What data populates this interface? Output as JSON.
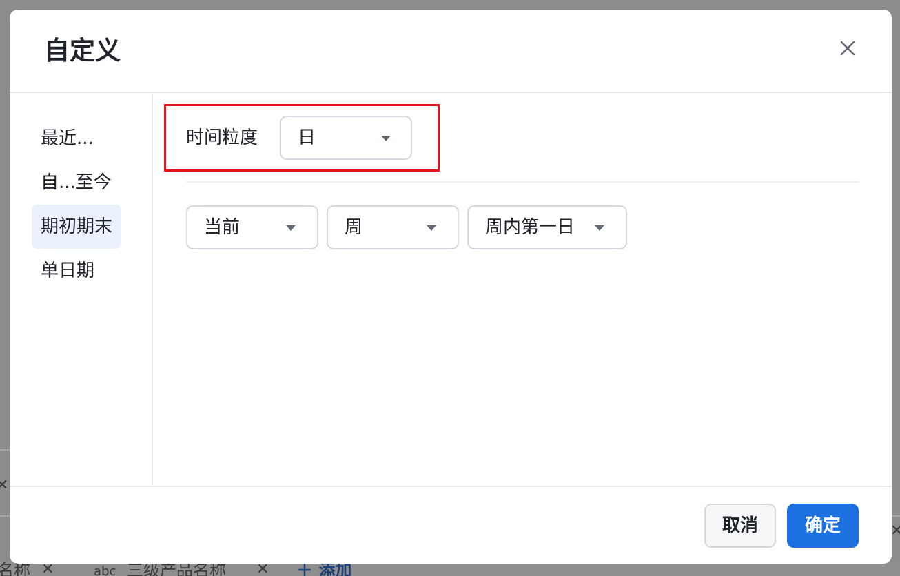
{
  "dialog": {
    "title": "自定义",
    "close_icon": "close-icon"
  },
  "sidebar": {
    "items": [
      {
        "label": "最近..."
      },
      {
        "label": "自...至今"
      },
      {
        "label": "期初期末",
        "active": true
      },
      {
        "label": "单日期"
      }
    ]
  },
  "granularity": {
    "label": "时间粒度",
    "value": "日"
  },
  "range_selects": [
    {
      "value": "当前"
    },
    {
      "value": "周"
    },
    {
      "value": "周内第一日"
    }
  ],
  "footer": {
    "cancel_label": "取消",
    "confirm_label": "确定"
  },
  "background": {
    "field_name_fragment": "名称",
    "field_type_prefix": "abc",
    "field_name": "三级产品名称",
    "add_label": "添加"
  },
  "colors": {
    "primary": "#1c70e0",
    "highlight": "#e5131a",
    "active_item_bg": "#eaf1fd",
    "overlay": "#8c8c8c"
  }
}
